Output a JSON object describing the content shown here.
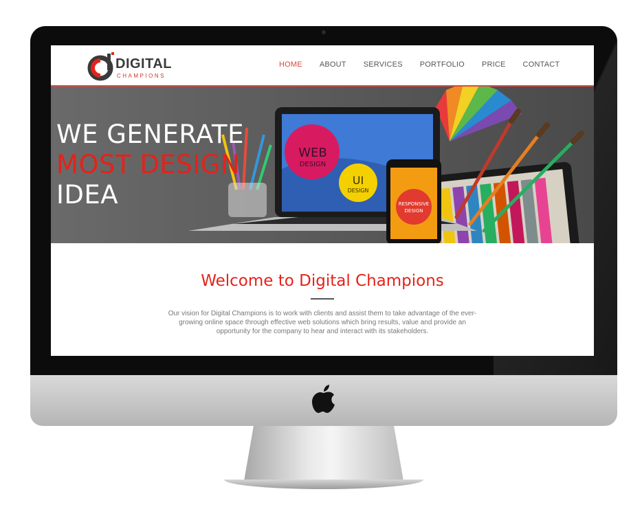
{
  "brand": {
    "title": "DIGITAL",
    "subtitle": "CHAMPIONS",
    "accent_color": "#e3231b",
    "dark_color": "#3a3a3a"
  },
  "nav": {
    "items": [
      {
        "label": "HOME",
        "active": true
      },
      {
        "label": "ABOUT",
        "active": false
      },
      {
        "label": "SERVICES",
        "active": false
      },
      {
        "label": "PORTFOLIO",
        "active": false
      },
      {
        "label": "PRICE",
        "active": false
      },
      {
        "label": "CONTACT",
        "active": false
      }
    ]
  },
  "hero": {
    "line1": "WE GENERATE",
    "line2": "MOST DESIGN",
    "line3": "IDEA",
    "laptop_circle1": "WEB",
    "laptop_circle1_sub": "DESIGN",
    "laptop_circle2": "UI",
    "laptop_circle2_sub": "DESIGN",
    "phone_circle1": "RESPONSIVE",
    "phone_circle2": "DESIGN"
  },
  "welcome": {
    "title": "Welcome to Digital Champions",
    "text": "Our vision for Digital Champions is to work with clients and assist them to take advantage of the ever-growing online space through effective web solutions which bring results, value and provide an opportunity for the company to hear and interact with its stakeholders."
  },
  "icons": [
    "apple-logo-icon",
    "brand-logo-icon"
  ]
}
